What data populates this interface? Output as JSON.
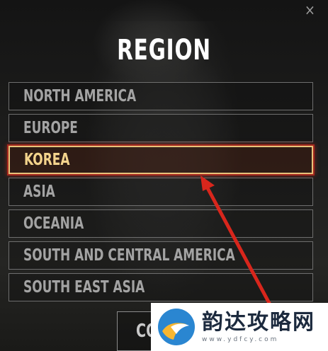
{
  "dialog": {
    "title": "REGION",
    "close_glyph": "×",
    "regions": [
      {
        "label": "NORTH AMERICA",
        "selected": false
      },
      {
        "label": "EUROPE",
        "selected": false
      },
      {
        "label": "KOREA",
        "selected": true
      },
      {
        "label": "ASIA",
        "selected": false
      },
      {
        "label": "OCEANIA",
        "selected": false
      },
      {
        "label": "SOUTH AND CENTRAL AMERICA",
        "selected": false
      },
      {
        "label": "SOUTH EAST ASIA",
        "selected": false
      }
    ],
    "confirm_label": "CONFIRM"
  },
  "watermark": {
    "title": "韵达攻略网",
    "url": "www.ydfcy.com"
  },
  "colors": {
    "selected_text": "#f3d38c",
    "selected_border": "#e8c27a",
    "annotation_arrow": "#d8261c",
    "item_text": "#a3a3a3"
  },
  "icons": {
    "close": "close-icon",
    "watermark_logo": "watermark-logo-icon",
    "annotation": "red-arrow-annotation"
  }
}
